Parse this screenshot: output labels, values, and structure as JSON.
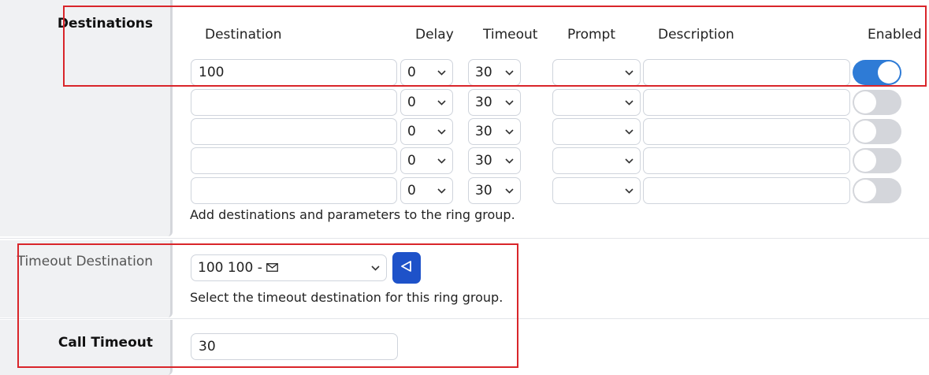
{
  "destinations": {
    "label": "Destinations",
    "columns": [
      "Destination",
      "Delay",
      "Timeout",
      "Prompt",
      "Description",
      "Enabled"
    ],
    "rows": [
      {
        "destination": "100",
        "delay": "0",
        "timeout": "30",
        "prompt": "",
        "description": "",
        "enabled": true
      },
      {
        "destination": "",
        "delay": "0",
        "timeout": "30",
        "prompt": "",
        "description": "",
        "enabled": false
      },
      {
        "destination": "",
        "delay": "0",
        "timeout": "30",
        "prompt": "",
        "description": "",
        "enabled": false
      },
      {
        "destination": "",
        "delay": "0",
        "timeout": "30",
        "prompt": "",
        "description": "",
        "enabled": false
      },
      {
        "destination": "",
        "delay": "0",
        "timeout": "30",
        "prompt": "",
        "description": "",
        "enabled": false
      }
    ],
    "hint": "Add destinations and parameters to the ring group."
  },
  "timeout_destination": {
    "label": "Timeout Destination",
    "value": "100 100 - ",
    "value_icon": "envelope-icon",
    "button_icon": "play-back-icon",
    "hint": "Select the timeout destination for this ring group."
  },
  "call_timeout": {
    "label": "Call Timeout",
    "value": "30"
  },
  "colors": {
    "toggle_on": "#2e7bd6",
    "toggle_off": "#d4d6db",
    "button": "#1e52c9",
    "highlight": "#d9252a",
    "label_bg": "#f0f1f3"
  }
}
